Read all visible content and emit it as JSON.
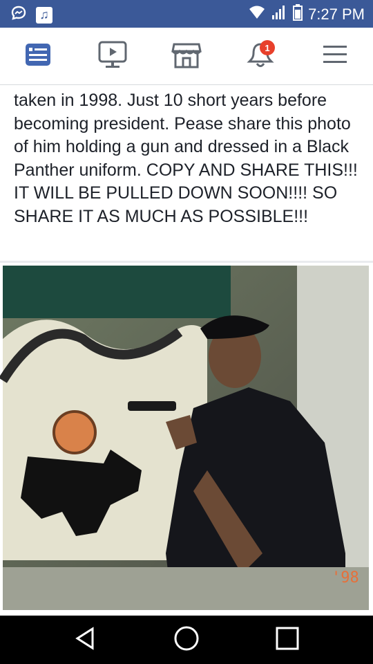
{
  "status_bar": {
    "time": "7:27 PM",
    "icons": [
      "messenger-icon",
      "music-app-icon",
      "wifi-icon",
      "signal-icon",
      "battery-icon"
    ]
  },
  "nav": {
    "items": [
      {
        "name": "news-feed",
        "icon": "news-feed-icon",
        "active": true
      },
      {
        "name": "watch",
        "icon": "video-play-icon"
      },
      {
        "name": "marketplace",
        "icon": "marketplace-store-icon"
      },
      {
        "name": "notifications",
        "icon": "bell-icon",
        "badge": "1"
      },
      {
        "name": "menu",
        "icon": "hamburger-menu-icon"
      }
    ],
    "active_color": "#4267b2"
  },
  "post": {
    "text": "taken in 1998. Just 10 short years before becoming president. Pease share this photo of him holding a gun and dressed in a Black Panther uniform. COPY AND SHARE THIS!!!  IT WILL BE PULLED DOWN SOON!!!! SO SHARE IT AS MUCH AS POSSIBLE!!!",
    "photo": {
      "description_icon": "photo-image",
      "date_stamp": "'98"
    }
  },
  "android_nav": {
    "buttons": [
      "back-icon",
      "home-icon",
      "recents-icon"
    ]
  }
}
